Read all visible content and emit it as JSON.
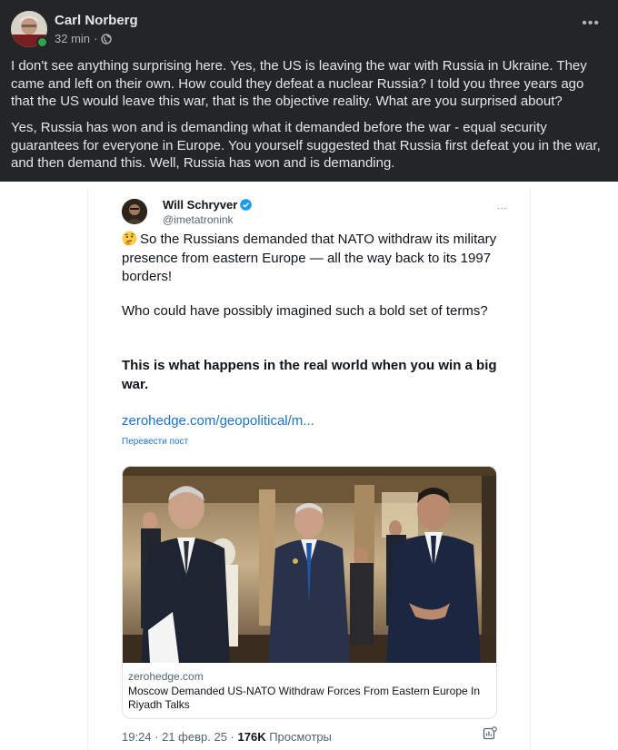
{
  "post": {
    "author": "Carl Norberg",
    "time": "32 min",
    "separator": "·",
    "more_label": "•••",
    "paragraph1": "I don't see anything surprising here. Yes, the US is leaving the war with Russia in Ukraine. They came and left on their own. How could they defeat a nuclear Russia? I told you three years ago that the US would leave this war, that is the objective reality. What are you surprised about?",
    "paragraph2": "Yes, Russia has won and is demanding what it demanded before the war - equal security guarantees for everyone in Europe. You yourself suggested that Russia first defeat you in the war, and then demand this. Well, Russia has won and is demanding."
  },
  "tweet": {
    "name": "Will Schryver",
    "handle": "@imetatronink",
    "more_label": "⋮",
    "paragraph1": "So the Russians demanded that NATO withdraw its military presence from eastern Europe — all the way back to its 1997 borders!",
    "paragraph2": "Who could have possibly imagined such a bold set of terms?",
    "paragraph3": "This is what happens in the real world when you win a big war.",
    "link": "zerohedge.com/geopolitical/m...",
    "translate": "Перевести пост",
    "card": {
      "domain": "zerohedge.com",
      "title": "Moscow Demanded US-NATO Withdraw Forces From Eastern Europe In Riyadh Talks"
    },
    "footer": {
      "time": "19:24",
      "separator1": " · ",
      "date": "21 февр. 25",
      "separator2": " · ",
      "views": "176K",
      "views_label": " Просмотры"
    }
  },
  "icons": {
    "globe": "globe-icon",
    "verified": "verified-badge-icon",
    "emoji": "thinking-face-emoji",
    "stats": "post-stats-icon"
  },
  "colors": {
    "fb_background": "#242526",
    "fb_text": "#e4e6eb",
    "online": "#31a24c",
    "link_blue": "#1d74c4",
    "verified_blue": "#1d9bf0"
  }
}
